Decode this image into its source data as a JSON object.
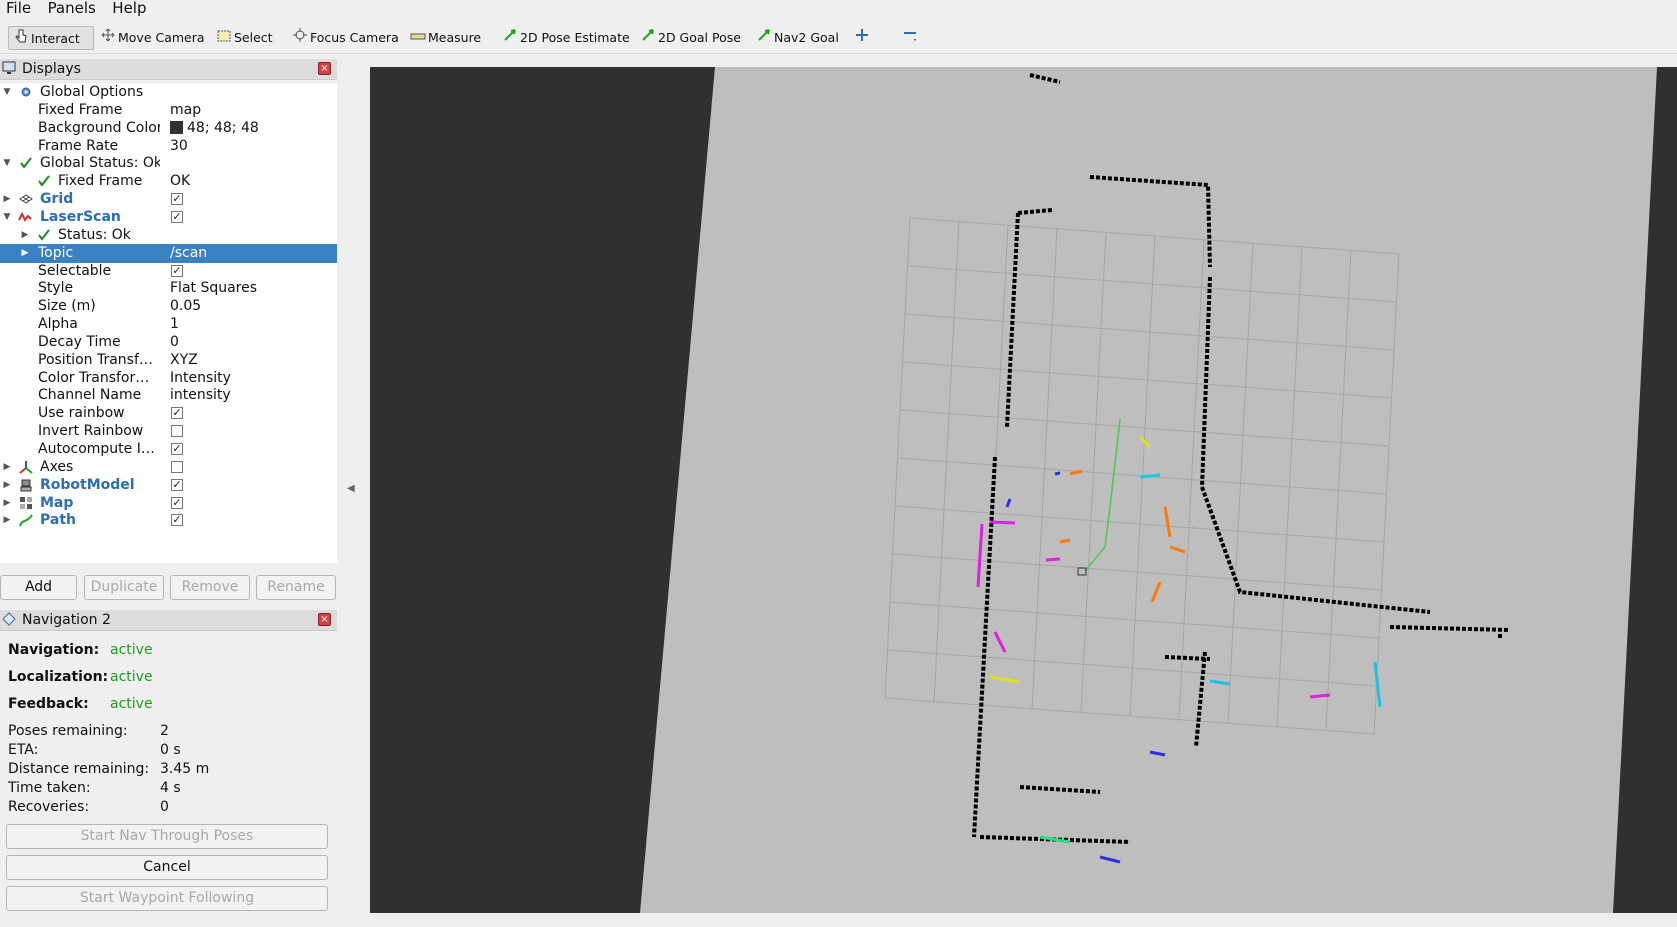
{
  "menu": [
    "File",
    "Panels",
    "Help"
  ],
  "toolbar": {
    "tools": [
      {
        "label": "Interact",
        "icon": "cursor-hand-icon",
        "active": true
      },
      {
        "label": "Move Camera",
        "icon": "move-camera-icon"
      },
      {
        "label": "Select",
        "icon": "select-box-icon"
      },
      {
        "label": "Focus Camera",
        "icon": "focus-camera-icon"
      },
      {
        "label": "Measure",
        "icon": "ruler-icon"
      },
      {
        "label": "2D Pose Estimate",
        "icon": "green-arrow-icon"
      },
      {
        "label": "2D Goal Pose",
        "icon": "green-arrow-icon"
      },
      {
        "label": "Nav2 Goal",
        "icon": "green-arrow-icon"
      },
      {
        "label": "",
        "icon": "plus-icon"
      },
      {
        "label": "",
        "icon": "minus-icon"
      }
    ]
  },
  "displays": {
    "title": "Displays",
    "rows": [
      {
        "label": "Global Options",
        "value": "",
        "depth": 0,
        "arrow": "down",
        "icon": "gear-icon"
      },
      {
        "label": "Fixed Frame",
        "value": "map",
        "depth": 1
      },
      {
        "label": "Background Color",
        "value": "48; 48; 48",
        "depth": 1,
        "swatch": true
      },
      {
        "label": "Frame Rate",
        "value": "30",
        "depth": 1
      },
      {
        "label": "Global Status: Ok",
        "value": "",
        "depth": 0,
        "arrow": "down",
        "icon": "check-icon"
      },
      {
        "label": "Fixed Frame",
        "value": "OK",
        "depth": 1,
        "icon": "check-icon"
      },
      {
        "label": "Grid",
        "value": "",
        "depth": 0,
        "arrow": "right",
        "icon": "grid-icon",
        "blue": true,
        "checkbox": "checked"
      },
      {
        "label": "LaserScan",
        "value": "",
        "depth": 0,
        "arrow": "down",
        "icon": "laserscan-icon",
        "blue": true,
        "checkbox": "checked"
      },
      {
        "label": "Status: Ok",
        "value": "",
        "depth": 1,
        "arrow": "right",
        "icon": "check-icon"
      },
      {
        "label": "Topic",
        "value": "/scan",
        "depth": 1,
        "arrow": "right",
        "selected": true
      },
      {
        "label": "Selectable",
        "value": "",
        "depth": 1,
        "checkbox": "checked"
      },
      {
        "label": "Style",
        "value": "Flat Squares",
        "depth": 1
      },
      {
        "label": "Size (m)",
        "value": "0.05",
        "depth": 1
      },
      {
        "label": "Alpha",
        "value": "1",
        "depth": 1
      },
      {
        "label": "Decay Time",
        "value": "0",
        "depth": 1
      },
      {
        "label": "Position Transf…",
        "value": "XYZ",
        "depth": 1
      },
      {
        "label": "Color Transfor…",
        "value": "Intensity",
        "depth": 1
      },
      {
        "label": "Channel Name",
        "value": "intensity",
        "depth": 1
      },
      {
        "label": "Use rainbow",
        "value": "",
        "depth": 1,
        "checkbox": "checked"
      },
      {
        "label": "Invert Rainbow",
        "value": "",
        "depth": 1,
        "checkbox": "unchecked"
      },
      {
        "label": "Autocompute I…",
        "value": "",
        "depth": 1,
        "checkbox": "checked"
      },
      {
        "label": "Axes",
        "value": "",
        "depth": 0,
        "arrow": "right",
        "icon": "axes-icon",
        "checkbox": "unchecked"
      },
      {
        "label": "RobotModel",
        "value": "",
        "depth": 0,
        "arrow": "right",
        "icon": "robot-icon",
        "blue": true,
        "checkbox": "checked"
      },
      {
        "label": "Map",
        "value": "",
        "depth": 0,
        "arrow": "right",
        "icon": "map-icon",
        "blue": true,
        "checkbox": "checked"
      },
      {
        "label": "Path",
        "value": "",
        "depth": 0,
        "arrow": "right",
        "icon": "path-icon",
        "blue": true,
        "checkbox": "checked"
      }
    ],
    "buttons": {
      "add": "Add",
      "duplicate": "Duplicate",
      "remove": "Remove",
      "rename": "Rename"
    }
  },
  "navigation": {
    "title": "Navigation 2",
    "status": [
      {
        "key": "Navigation:",
        "value": "active"
      },
      {
        "key": "Localization:",
        "value": "active"
      },
      {
        "key": "Feedback:",
        "value": "active"
      }
    ],
    "metrics": [
      {
        "key": "Poses remaining:",
        "value": "2"
      },
      {
        "key": "ETA:",
        "value": "0 s"
      },
      {
        "key": "Distance remaining:",
        "value": "3.45 m"
      },
      {
        "key": "Time taken:",
        "value": "4 s"
      },
      {
        "key": "Recoveries:",
        "value": "0"
      }
    ],
    "buttons": {
      "start_nav": "Start Nav Through Poses",
      "cancel": "Cancel",
      "start_waypoint": "Start Waypoint Following"
    }
  },
  "colors": {
    "accent": "#3a81c4",
    "active": "#1e9a1e",
    "viewport_bg": "#303030",
    "map_free": "#bebebe"
  }
}
